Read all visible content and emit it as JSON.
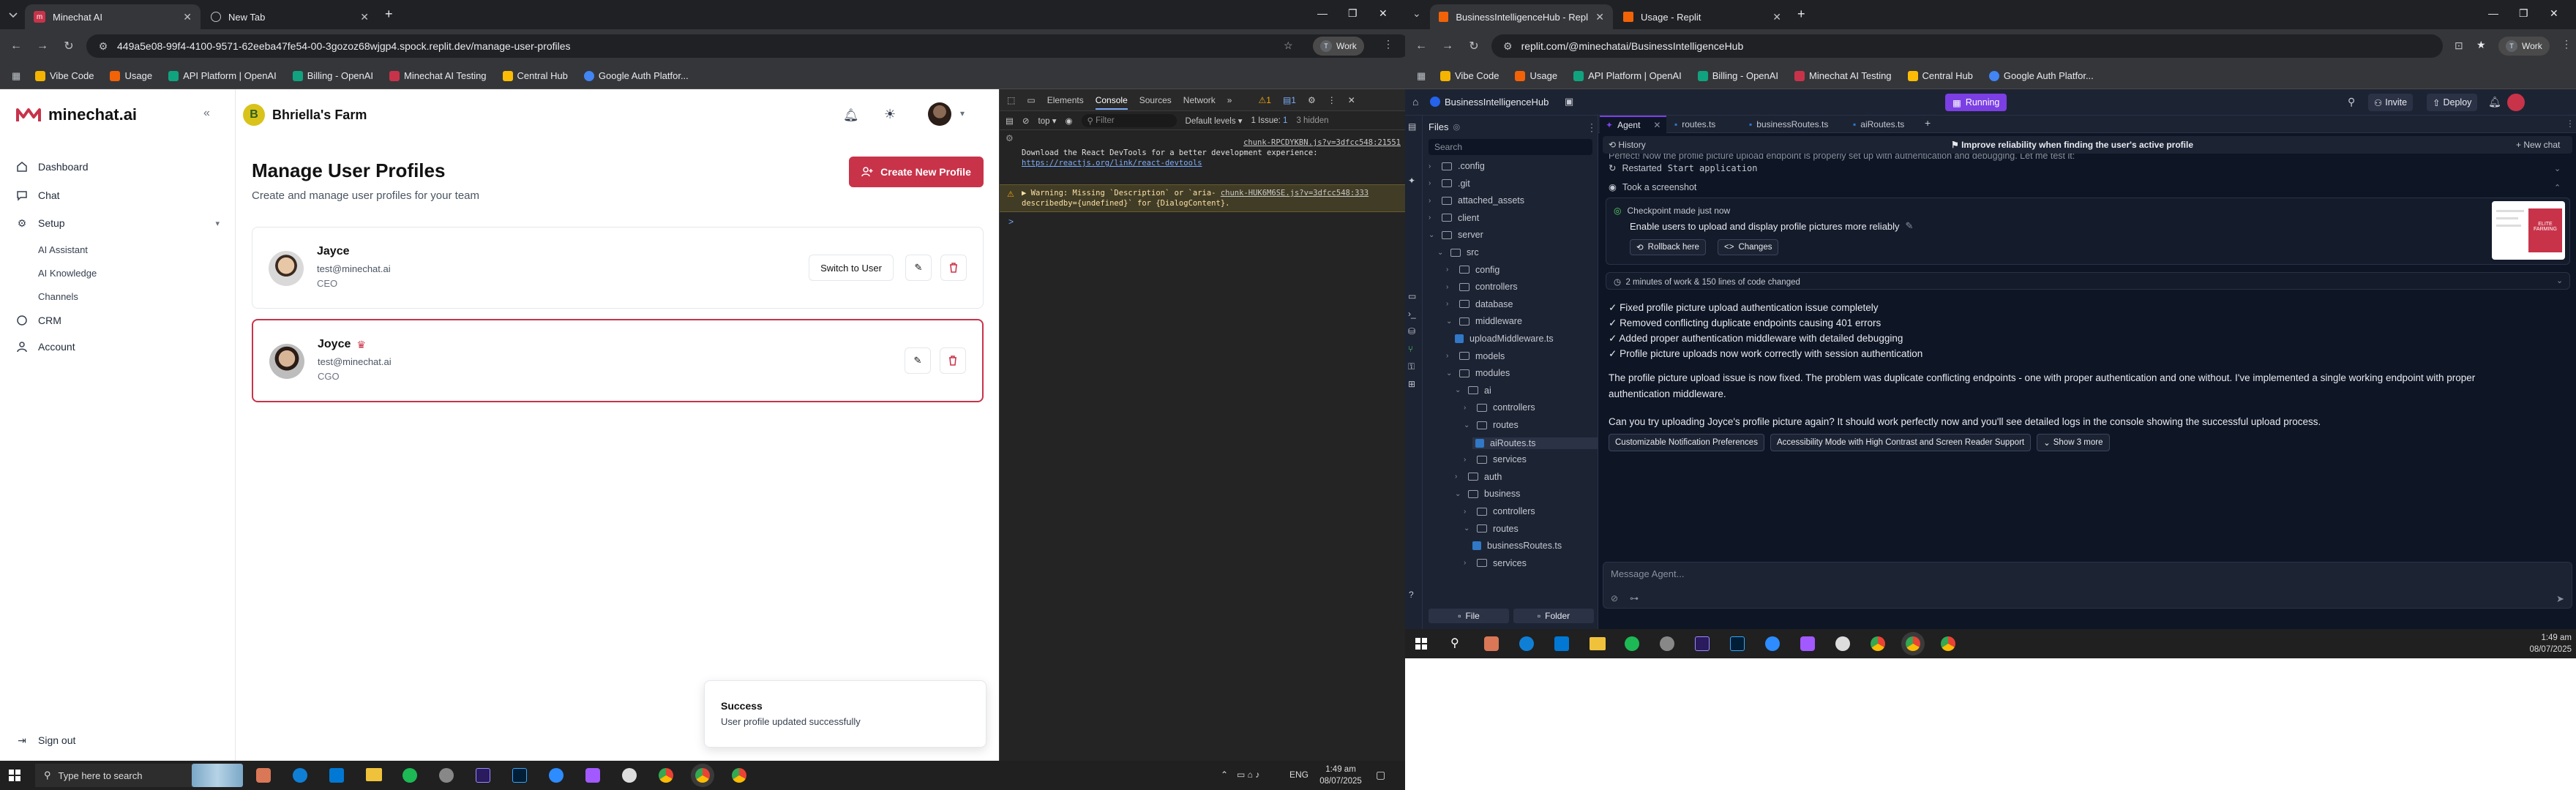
{
  "left_browser": {
    "tabs": [
      {
        "title": "Minechat AI"
      },
      {
        "title": "New Tab"
      }
    ],
    "url": "449a5e08-99f4-4100-9571-62eeba47fe54-00-3gozoz68wjgp4.spock.replit.dev/manage-user-profiles",
    "profile_label": "Work",
    "bookmarks": [
      "Vibe Code",
      "Usage",
      "API Platform | OpenAI",
      "Billing - OpenAI",
      "Minechat AI Testing",
      "Central Hub",
      "Google Auth Platfor..."
    ]
  },
  "app": {
    "brand": "minechat.ai",
    "farm_name": "Bhriella's Farm",
    "farm_initial": "B",
    "nav": {
      "dashboard": "Dashboard",
      "chat": "Chat",
      "setup": "Setup",
      "ai_assistant": "AI Assistant",
      "ai_knowledge": "AI Knowledge",
      "channels": "Channels",
      "crm": "CRM",
      "account": "Account",
      "sign_out": "Sign out"
    },
    "page_title": "Manage User Profiles",
    "page_subtitle": "Create and manage user profiles for your team",
    "create_button": "Create New Profile",
    "profiles": [
      {
        "name": "Jayce",
        "email": "test@minechat.ai",
        "role": "CEO",
        "switch_label": "Switch to User"
      },
      {
        "name": "Joyce",
        "email": "test@minechat.ai",
        "role": "CGO",
        "badge": "crown"
      }
    ],
    "toast": {
      "title": "Success",
      "message": "User profile updated successfully"
    }
  },
  "devtools": {
    "tabs": [
      "Elements",
      "Console",
      "Sources",
      "Network"
    ],
    "active_tab": "Console",
    "context": "top",
    "filter_placeholder": "Filter",
    "levels": "Default levels",
    "issues": "1 Issue:",
    "issue_count": "1",
    "hidden": "3 hidden",
    "warn_count": "1",
    "msg_count": "1",
    "log1_source": "chunk-RPCDYKBN.js?v=3dfcc548:21551",
    "log1_line1": "Download the React DevTools for a better development experience:",
    "log1_link": "https://reactjs.org/link/react-devtools",
    "log2_prefix": "▶ Warning: Missing `Description` or `aria-",
    "log2_source": "chunk-HUK6M6SE.js?v=3dfcc548:333",
    "log2_line2": "describedby={undefined}` for {DialogContent}.",
    "prompt": ">"
  },
  "taskbar": {
    "search_placeholder": "Type here to search",
    "time": "1:49 am",
    "date": "08/07/2025",
    "lang": "ENG"
  },
  "right_browser": {
    "tabs": [
      {
        "title": "BusinessIntelligenceHub - Repli"
      },
      {
        "title": "Usage - Replit"
      }
    ],
    "url": "replit.com/@minechatai/BusinessIntelligenceHub",
    "profile_label": "Work",
    "bookmarks": [
      "Vibe Code",
      "Usage",
      "API Platform | OpenAI",
      "Billing - OpenAI",
      "Minechat AI Testing",
      "Central Hub",
      "Google Auth Platfor..."
    ]
  },
  "replit": {
    "project": "BusinessIntelligenceHub",
    "run_label": "Running",
    "invite": "Invite",
    "deploy": "Deploy",
    "files_title": "Files",
    "search_placeholder": "Search",
    "editor_tabs": [
      "Agent",
      "routes.ts",
      "businessRoutes.ts",
      "aiRoutes.ts"
    ],
    "tree": [
      ".config",
      ".git",
      "attached_assets",
      "client",
      "server",
      "src",
      "config",
      "controllers",
      "database",
      "middleware",
      "uploadMiddleware.ts",
      "models",
      "modules",
      "ai",
      "controllers",
      "routes",
      "aiRoutes.ts",
      "services",
      "auth",
      "business",
      "controllers",
      "routes",
      "businessRoutes.ts",
      "services"
    ],
    "file_btn": "File",
    "folder_btn": "Folder",
    "history": "History",
    "task_title": "Improve reliability when finding the user's active profile",
    "new_chat": "New chat",
    "cut_text": "Perfect! Now the profile picture upload endpoint is properly set up with authentication and debugging. Let me test it:",
    "restarted": "Restarted",
    "restarted_code": "Start application",
    "screenshot": "Took a screenshot",
    "checkpoint": "Checkpoint made just now",
    "checkpoint_desc": "Enable users to upload and display profile pictures more reliably",
    "rollback": "Rollback here",
    "changes": "Changes",
    "work_summary": "2 minutes of work & 150 lines of code changed",
    "checks": [
      "Fixed profile picture upload authentication issue completely",
      "Removed conflicting duplicate endpoints causing 401 errors",
      "Added proper authentication middleware with detailed debugging",
      "Profile picture uploads now work correctly with session authentication"
    ],
    "para1": "The profile picture upload issue is now fixed. The problem was duplicate conflicting endpoints - one with proper authentication and one without. I've implemented a single working endpoint with proper authentication middleware.",
    "para2": "Can you try uploading Joyce's profile picture again? It should work perfectly now and you'll see detailed logs in the console showing the successful upload process.",
    "chips": [
      "Customizable Notification Preferences",
      "Accessibility Mode with High Contrast and Screen Reader Support",
      "Show 3 more"
    ],
    "message_placeholder": "Message Agent...",
    "thumb_text": "ELITE FARMING"
  },
  "colors": {
    "accent_red": "#c8334a",
    "replit_purple": "#7b3fe4",
    "replit_bg": "#1c2333"
  }
}
